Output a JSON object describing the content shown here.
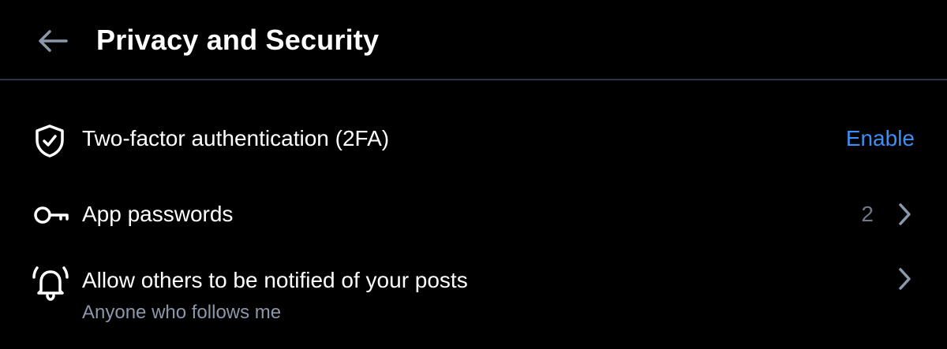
{
  "header": {
    "title": "Privacy and Security",
    "back_icon": "arrow-left-icon"
  },
  "rows": [
    {
      "icon": "shield-check-icon",
      "label": "Two-factor authentication (2FA)",
      "action_label": "Enable"
    },
    {
      "icon": "key-icon",
      "label": "App passwords",
      "count": "2",
      "trailing_icon": "chevron-right-icon"
    },
    {
      "icon": "bell-ringing-icon",
      "label": "Allow others to be notified of your posts",
      "sublabel": "Anyone who follows me",
      "trailing_icon": "chevron-right-icon"
    }
  ],
  "colors": {
    "background": "#000000",
    "text": "#ffffff",
    "accent": "#3b8ff7",
    "secondary_text": "#8b97aa",
    "muted": "#6e7888",
    "divider": "#2e3540"
  }
}
